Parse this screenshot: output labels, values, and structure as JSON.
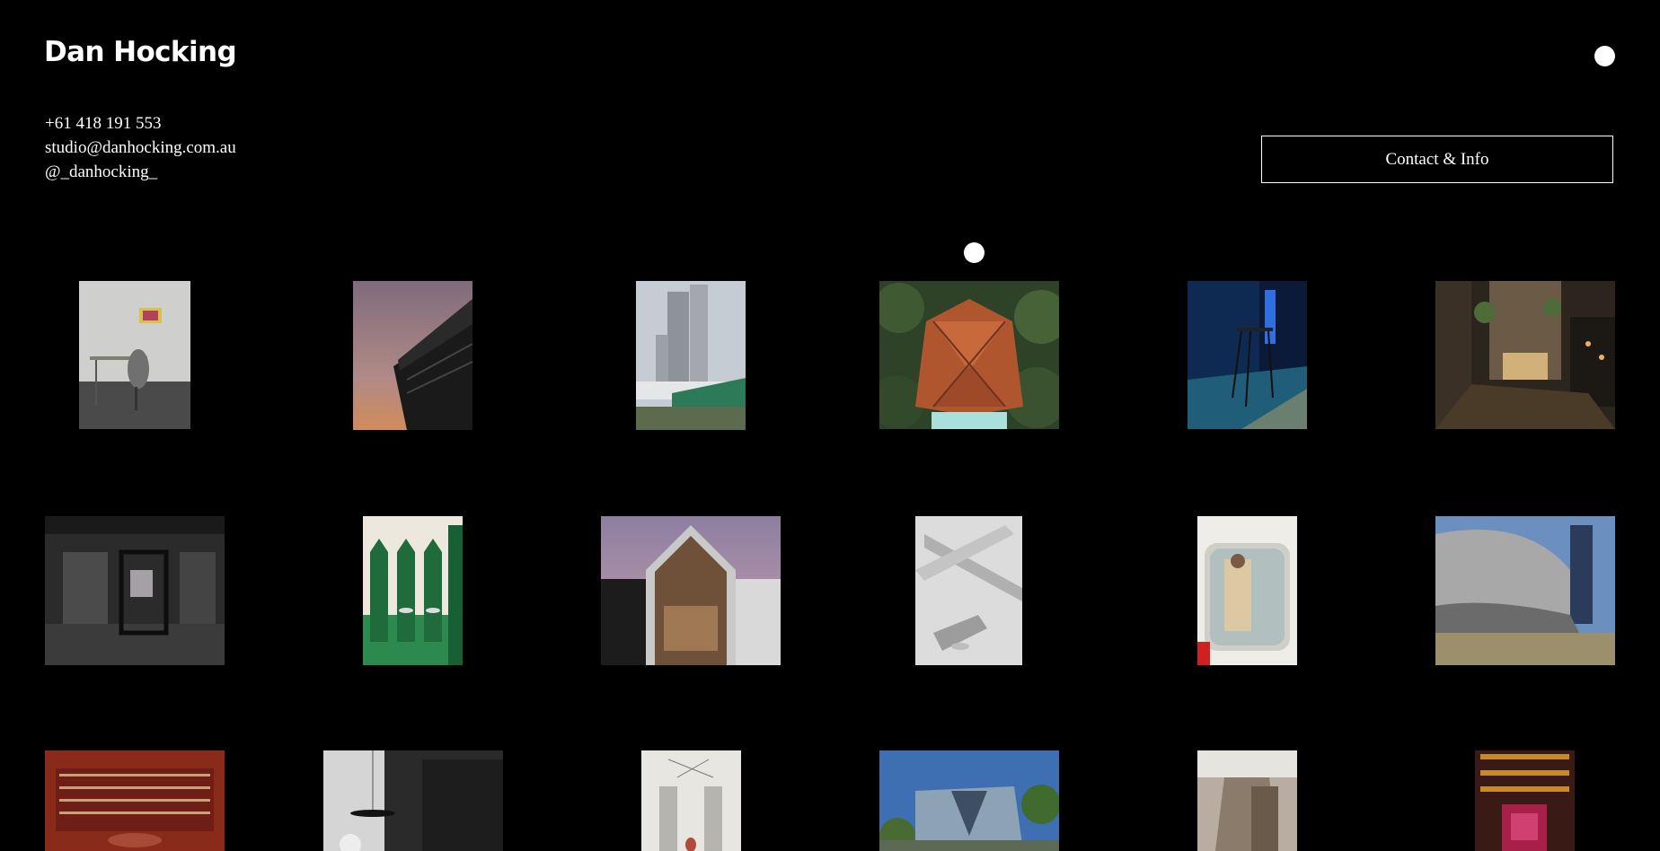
{
  "site": {
    "name": "Dan Hocking"
  },
  "contact": {
    "phone": "+61 418 191 553",
    "email": "studio@danhocking.com.au",
    "instagram": "@_danhocking_",
    "button_label": "Contact & Info"
  },
  "icons": {
    "menu": "circle-menu-icon",
    "cursor": "circle-cursor-icon"
  },
  "colors": {
    "background": "#000000",
    "text": "#ffffff"
  }
}
